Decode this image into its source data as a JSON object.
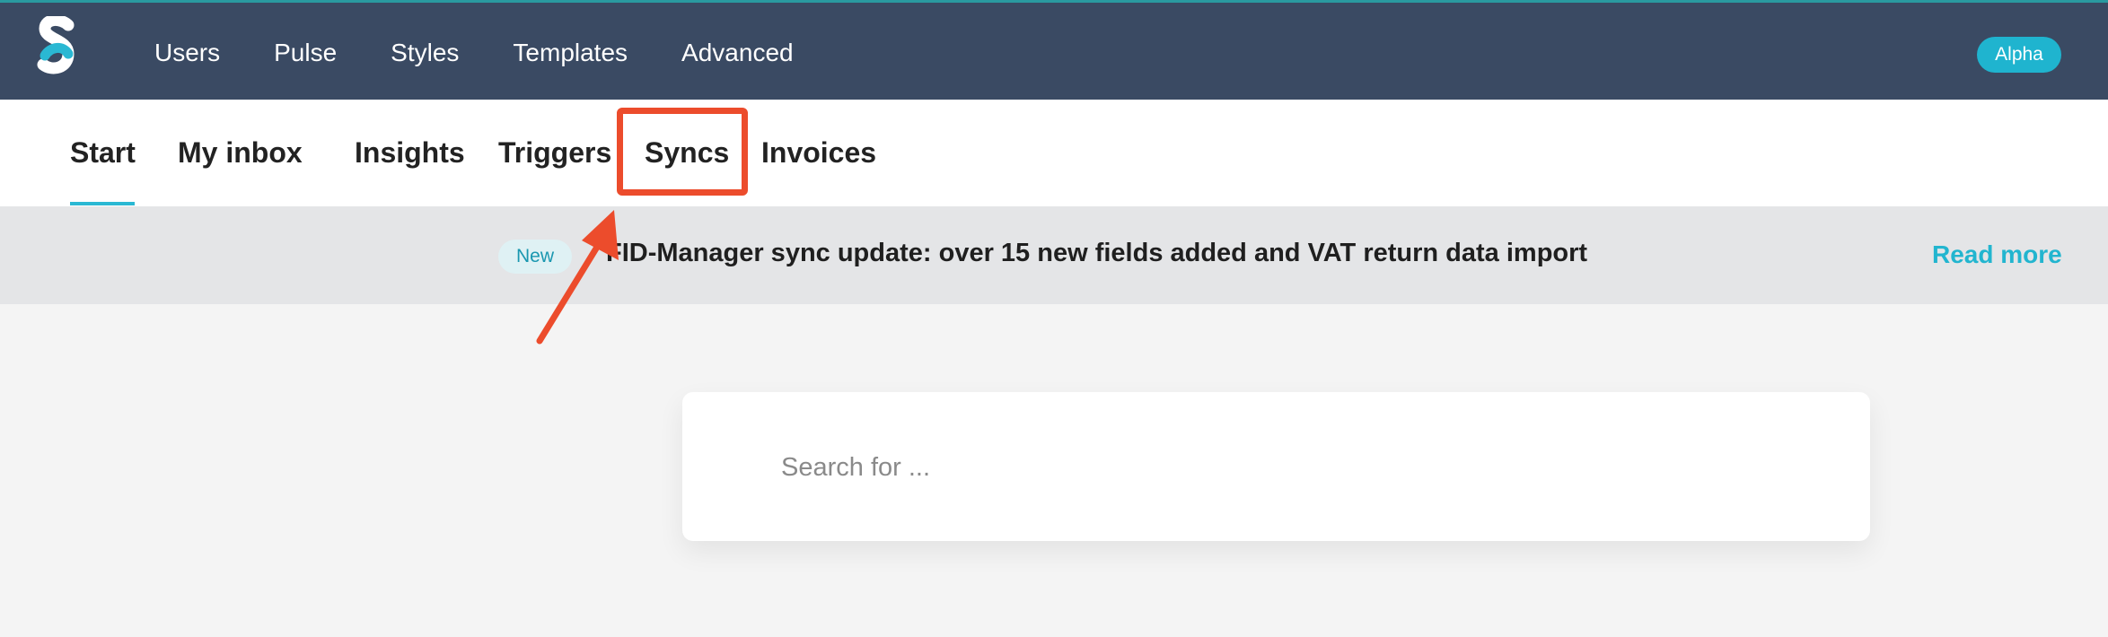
{
  "topbar": {
    "nav": [
      "Users",
      "Pulse",
      "Styles",
      "Templates",
      "Advanced"
    ],
    "badge": "Alpha",
    "colors": {
      "background": "#3a4a63",
      "badge": "#1fb4cf"
    }
  },
  "subnav": {
    "tabs": [
      "Start",
      "My inbox",
      "Insights",
      "Triggers",
      "Syncs",
      "Invoices"
    ],
    "active": "Start",
    "highlighted": "Syncs",
    "colors": {
      "underline": "#2ab8d3",
      "highlight": "#ec4c2c"
    }
  },
  "banner": {
    "badge": "New",
    "text": "FID-Manager sync update: over 15 new fields added and VAT return data import",
    "link": "Read more"
  },
  "search": {
    "placeholder": "Search for ..."
  },
  "icons": {
    "logo": "s-logo-icon",
    "annotation": "red-arrow-icon"
  }
}
